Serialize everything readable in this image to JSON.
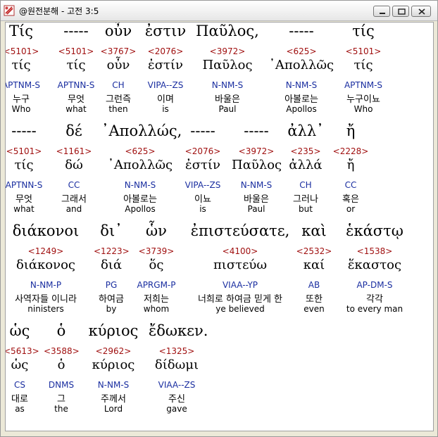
{
  "window": {
    "title": "@원전분해 - 고전 3:5"
  },
  "lines": [
    {
      "words": [
        {
          "greek": "Τίς",
          "strong": "<5101>",
          "lemma": "τίς",
          "parse": "APTNM-S",
          "korean": "누구",
          "english": "Who"
        },
        {
          "greek": "-----",
          "strong": "<5101>",
          "lemma": "τίς",
          "parse": "APTNN-S",
          "korean": "무엇",
          "english": "what"
        },
        {
          "greek": "οὖν",
          "strong": "<3767>",
          "lemma": "οὖν",
          "parse": "CH",
          "korean": "그런즉",
          "english": "then"
        },
        {
          "greek": "ἐστιν",
          "strong": "<2076>",
          "lemma": "ἐστίν",
          "parse": "VIPA--ZS",
          "korean": "이며",
          "english": "is"
        },
        {
          "greek": "Παῦλος,",
          "strong": "<3972>",
          "lemma": "Παῦλος",
          "parse": "N-NM-S",
          "korean": "바울은",
          "english": "Paul"
        },
        {
          "greek": "-----",
          "strong": "<625>",
          "lemma": "᾿Απολλῶς",
          "parse": "N-NM-S",
          "korean": "아볼로는",
          "english": "Apollos"
        },
        {
          "greek": "τίς",
          "strong": "<5101>",
          "lemma": "τίς",
          "parse": "APTNM-S",
          "korean": "누구이뇨",
          "english": "Who"
        }
      ]
    },
    {
      "words": [
        {
          "greek": "-----",
          "strong": "<5101>",
          "lemma": "τίς",
          "parse": "APTNN-S",
          "korean": "무엇",
          "english": "what"
        },
        {
          "greek": "δέ",
          "strong": "<1161>",
          "lemma": "δώ",
          "parse": "CC",
          "korean": "그래서",
          "english": "and"
        },
        {
          "greek": "᾿Απολλώς,",
          "strong": "<625>",
          "lemma": "᾿Απολλῶς",
          "parse": "N-NM-S",
          "korean": "아볼로는",
          "english": "Apollos"
        },
        {
          "greek": "-----",
          "strong": "<2076>",
          "lemma": "ἐστίν",
          "parse": "VIPA--ZS",
          "korean": "이뇨",
          "english": "is"
        },
        {
          "greek": "-----",
          "strong": "<3972>",
          "lemma": "Παῦλος",
          "parse": "N-NM-S",
          "korean": "바울은",
          "english": "Paul"
        },
        {
          "greek": "ἀλλ᾿",
          "strong": "<235>",
          "lemma": "ἀλλά",
          "parse": "CH",
          "korean": "그러나",
          "english": "but"
        },
        {
          "greek": "ἤ",
          "strong": "<2228>",
          "lemma": "ἤ",
          "parse": "CC",
          "korean": "혹은",
          "english": "or"
        }
      ]
    },
    {
      "words": [
        {
          "greek": "διάκονοι",
          "strong": "<1249>",
          "lemma": "διάκονος",
          "parse": "N-NM-P",
          "korean": "사역자들 이니라",
          "english": "ninisters"
        },
        {
          "greek": "δι᾿",
          "strong": "<1223>",
          "lemma": "διά",
          "parse": "PG",
          "korean": "하여금",
          "english": "by"
        },
        {
          "greek": "ὧν",
          "strong": "<3739>",
          "lemma": "ὅς",
          "parse": "APRGM-P",
          "korean": "저희는",
          "english": "whom"
        },
        {
          "greek": "ἐπιστεύσατε,",
          "strong": "<4100>",
          "lemma": "πιστεύω",
          "parse": "VIAA--YP",
          "korean": "너희로 하여금 믿게 한",
          "english": "ye believed"
        },
        {
          "greek": "καὶ",
          "strong": "<2532>",
          "lemma": "καί",
          "parse": "AB",
          "korean": "또한",
          "english": "even"
        },
        {
          "greek": "ἑκάστῳ",
          "strong": "<1538>",
          "lemma": "ἕκαστος",
          "parse": "AP-DM-S",
          "korean": "각각",
          "english": "to every man"
        }
      ]
    },
    {
      "words": [
        {
          "greek": "ὡς",
          "strong": "<5613>",
          "lemma": "ὡς",
          "parse": "CS",
          "korean": "대로",
          "english": "as"
        },
        {
          "greek": "ὁ",
          "strong": "<3588>",
          "lemma": "ὁ",
          "parse": "DNMS",
          "korean": "그",
          "english": "the"
        },
        {
          "greek": "κύριος",
          "strong": "<2962>",
          "lemma": "κύριος",
          "parse": "N-NM-S",
          "korean": "주께서",
          "english": "Lord"
        },
        {
          "greek": "ἔδωκεν.",
          "strong": "<1325>",
          "lemma": "δίδωμι",
          "parse": "VIAA--ZS",
          "korean": "주신",
          "english": "gave"
        }
      ]
    }
  ]
}
